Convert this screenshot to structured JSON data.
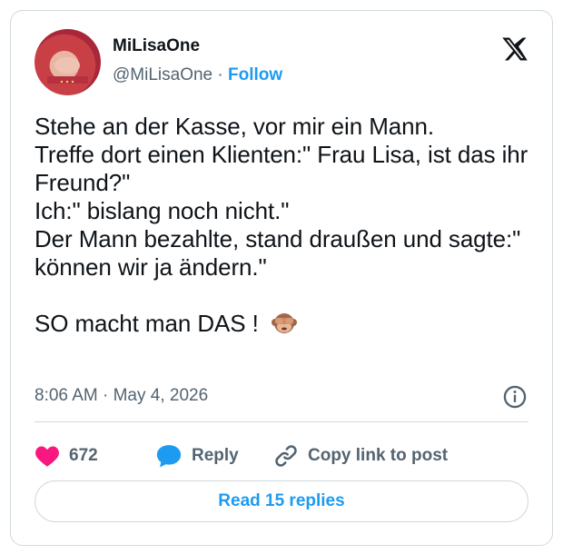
{
  "author": {
    "display_name": "MiLisaOne",
    "handle": "@MiLisaOne",
    "separator": " · ",
    "follow_label": "Follow",
    "avatar_icon": "avatar-photo"
  },
  "platform_icon": "x-logo-icon",
  "tweet": {
    "lines": [
      "Stehe an der Kasse, vor mir ein Mann.",
      "Treffe dort einen Klienten:\" Frau Lisa, ist das ihr Freund?\"",
      "Ich:\" bislang noch nicht.\"",
      "Der Mann bezahlte, stand draußen und sagte:\" können wir ja ändern.\"",
      "",
      "SO macht man DAS ! "
    ],
    "emoji_icon": "see-no-evil-monkey-icon"
  },
  "meta": {
    "time": "8:06 AM",
    "separator": " · ",
    "date": "May 4, 2026"
  },
  "actions": {
    "like_count": "672",
    "reply_label": "Reply",
    "copy_link_label": "Copy link to post"
  },
  "read_replies_label": "Read 15 replies",
  "colors": {
    "accent": "#1d9bf0",
    "like": "#f91880",
    "text": "#0f1419",
    "muted": "#536471",
    "border": "#cfd9de"
  }
}
